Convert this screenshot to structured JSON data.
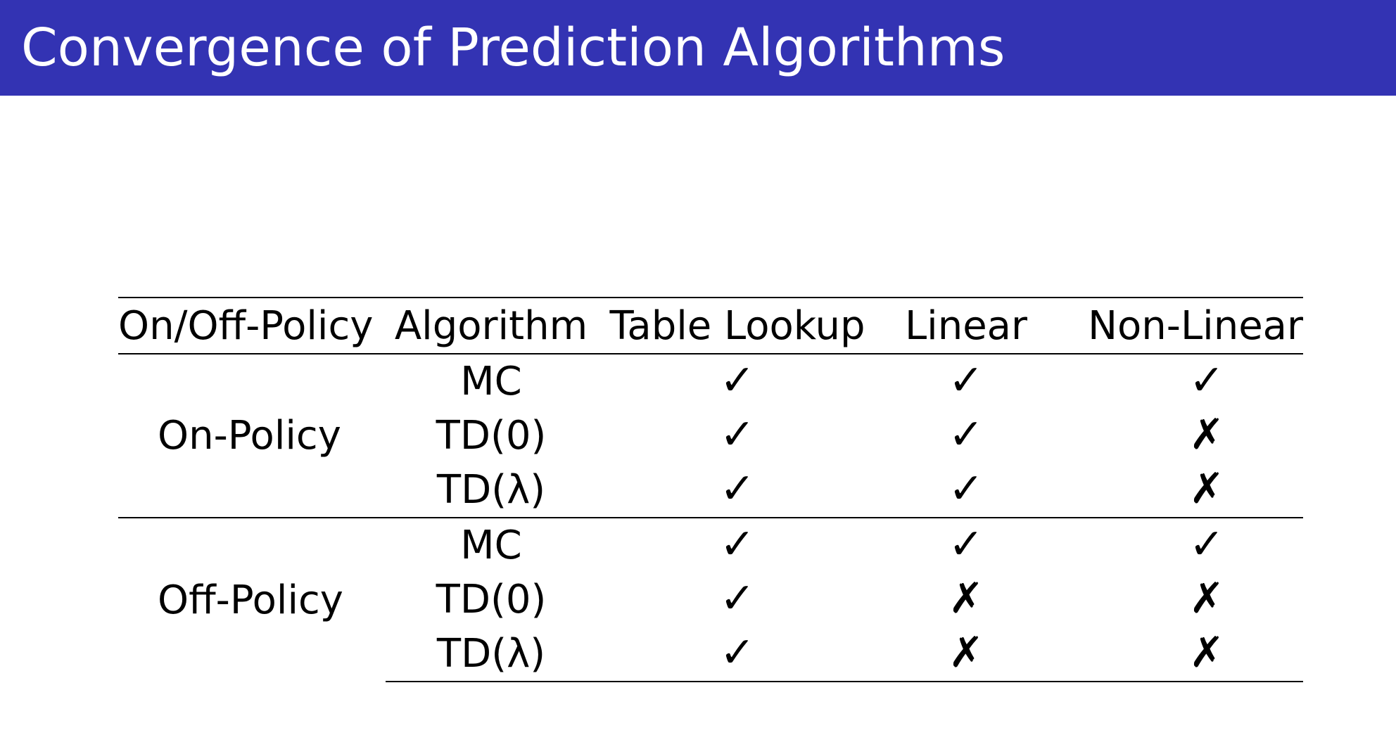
{
  "title": "Convergence of Prediction Algorithms",
  "headers": {
    "policy": "On/Off-Policy",
    "algorithm": "Algorithm",
    "table_lookup": "Table Lookup",
    "linear": "Linear",
    "non_linear": "Non-Linear"
  },
  "groups": [
    {
      "policy": "On-Policy",
      "rows": [
        {
          "algorithm": "MC",
          "table_lookup": "✓",
          "linear": "✓",
          "non_linear": "✓"
        },
        {
          "algorithm": "TD(0)",
          "table_lookup": "✓",
          "linear": "✓",
          "non_linear": "✗"
        },
        {
          "algorithm": "TD(λ)",
          "table_lookup": "✓",
          "linear": "✓",
          "non_linear": "✗"
        }
      ]
    },
    {
      "policy": "Off-Policy",
      "rows": [
        {
          "algorithm": "MC",
          "table_lookup": "✓",
          "linear": "✓",
          "non_linear": "✓"
        },
        {
          "algorithm": "TD(0)",
          "table_lookup": "✓",
          "linear": "✗",
          "non_linear": "✗"
        },
        {
          "algorithm": "TD(λ)",
          "table_lookup": "✓",
          "linear": "✗",
          "non_linear": "✗"
        }
      ]
    }
  ],
  "colors": {
    "title_bar": "#3333b3",
    "title_text": "#ffffff"
  }
}
